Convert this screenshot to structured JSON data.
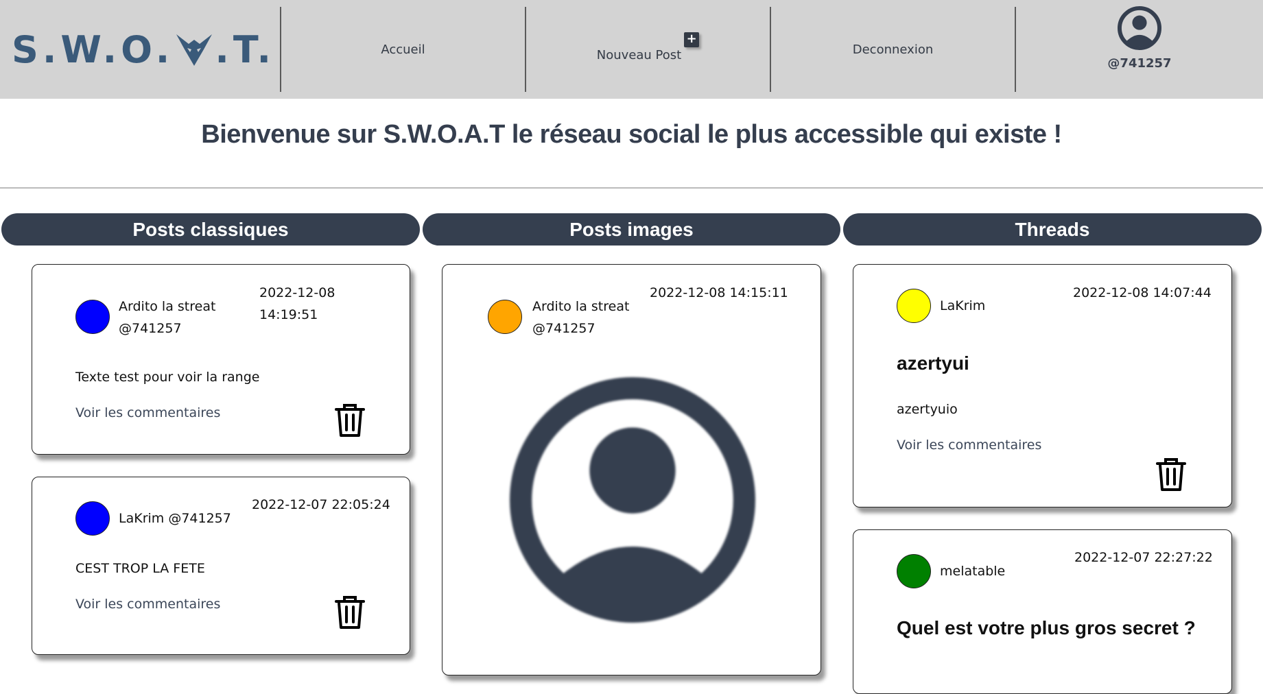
{
  "header": {
    "logo_text": "S.W.O.A.T.",
    "nav": {
      "home_label": "Accueil",
      "new_post_label": "Nouveau Post",
      "new_post_badge": "+",
      "logout_label": "Deconnexion"
    },
    "profile": {
      "handle": "@741257",
      "icon": "user-circle-icon"
    }
  },
  "welcome_text": "Bienvenue sur S.W.O.A.T le réseau social le plus accessible qui existe !",
  "columns": {
    "classic": "Posts classiques",
    "images": "Posts images",
    "threads": "Threads"
  },
  "classic_posts": [
    {
      "author": "Ardito la streat",
      "handle": "@741257",
      "date": "2022-12-08",
      "time": "14:19:51",
      "text": "Texte test pour voir la range",
      "link": "Voir les commentaires",
      "avatar_color": "#0000ff"
    },
    {
      "author_line": "LaKrim @741257",
      "datetime": "2022-12-07 22:05:24",
      "text": "CEST TROP LA FETE",
      "link": "Voir les commentaires",
      "avatar_color": "#0000ff"
    }
  ],
  "image_posts": [
    {
      "author": "Ardito la streat",
      "handle": "@741257",
      "datetime": "2022-12-08 14:15:11",
      "avatar_color": "#ffa500",
      "image_icon": "user-circle-icon"
    }
  ],
  "threads": [
    {
      "author": "LaKrim",
      "datetime": "2022-12-08 14:07:44",
      "title": "azertyui",
      "text": "azertyuio",
      "link": "Voir les commentaires",
      "avatar_color": "#ffff00"
    },
    {
      "author": "melatable",
      "datetime": "2022-12-07 22:27:22",
      "title": "Quel est votre plus gros secret ?",
      "avatar_color": "#008000"
    }
  ],
  "colors": {
    "header_bg": "#d3d3d3",
    "accent_dark": "#353f4f",
    "logo_blue": "#3a5a7a"
  }
}
